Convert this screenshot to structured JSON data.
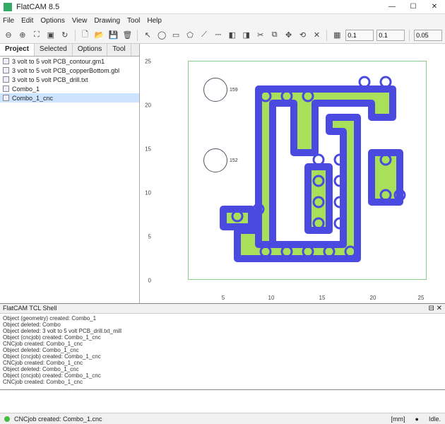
{
  "window": {
    "title": "FlatCAM 8.5"
  },
  "menubar": [
    "File",
    "Edit",
    "Options",
    "View",
    "Drawing",
    "Tool",
    "Help"
  ],
  "tooltips": {
    "zoom_out": "Zoom Out",
    "zoom_in": "Zoom In",
    "zoom_fit": "Zoom Fit",
    "clear_plot": "Clear Plot",
    "replot": "Replot",
    "new": "New",
    "open": "Open",
    "save": "Save",
    "delete": "Delete",
    "cursor": "Select",
    "circle": "Circle",
    "rect": "Rectangle",
    "polygon": "Polygon",
    "path": "Path",
    "union": "Union",
    "intersect": "Intersection",
    "subtract": "Subtract",
    "cut": "Cut Path",
    "copy": "Copy",
    "move": "Move",
    "rotate": "Rotate",
    "del_shape": "Delete Shape",
    "grid": "Grid"
  },
  "toolbar_inputs": {
    "grid_x": "0.1",
    "grid_y": "0.1",
    "grid_gap": "0.05"
  },
  "sidebar": {
    "tabs": [
      "Project",
      "Selected",
      "Options",
      "Tool"
    ],
    "active_tab": 0,
    "items": [
      {
        "label": "3 volt to 5 volt PCB_contour.gm1"
      },
      {
        "label": "3 volt to 5 volt PCB_copperBottom.gbl"
      },
      {
        "label": "3 volt to 5 volt PCB_drill.txt"
      },
      {
        "label": "Combo_1"
      },
      {
        "label": "Combo_1_cnc"
      }
    ],
    "selected": 4
  },
  "axes": {
    "y_ticks": [
      "25",
      "20",
      "15",
      "10",
      "5",
      "0"
    ],
    "x_ticks": [
      "5",
      "10",
      "15",
      "20",
      "25"
    ]
  },
  "labels": {
    "d1": "159",
    "d2": "152"
  },
  "shell": {
    "title": "FlatCAM TCL Shell",
    "lines": [
      "Object (geometry) created: Combo_1",
      "Object deleted: Combo",
      "Object deleted: 3 volt to 5 volt PCB_drill.txt_mill",
      "Object (cncjob) created: Combo_1_cnc",
      "CNCjob created: Combo_1_cnc",
      "Object deleted: Combo_1_cnc",
      "Object (cncjob) created: Combo_1_cnc",
      "CNCjob created: Combo_1_cnc",
      "Object deleted: Combo_1_cnc",
      "Object (cncjob) created: Combo_1_cnc",
      "CNCjob created: Combo_1_cnc"
    ]
  },
  "status": {
    "message": "CNCjob created: Combo_1.cnc",
    "units": "[mm]",
    "state": "Idle."
  }
}
